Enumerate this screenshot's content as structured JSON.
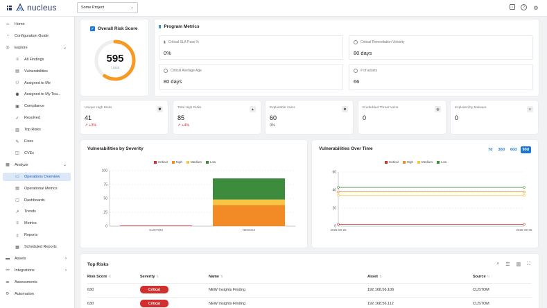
{
  "app": {
    "name": "nucleus",
    "project": "Some Project"
  },
  "sidebar": {
    "items": [
      {
        "label": "Home",
        "icon": "home-icon",
        "level": 1
      },
      {
        "label": "Configuration Guide",
        "icon": "guide-icon",
        "level": 1
      },
      {
        "label": "Explore",
        "icon": "explore-icon",
        "level": 1,
        "caret": "⌄"
      },
      {
        "label": "All Findings",
        "icon": "list-icon",
        "level": 2
      },
      {
        "label": "Vulnerabilities",
        "icon": "vuln-icon",
        "level": 2
      },
      {
        "label": "Assigned to Me",
        "icon": "person-icon",
        "level": 2
      },
      {
        "label": "Assigned to My Tea...",
        "icon": "team-icon",
        "level": 2
      },
      {
        "label": "Compliance",
        "icon": "compliance-icon",
        "level": 2
      },
      {
        "label": "Resolved",
        "icon": "check-icon",
        "level": 2
      },
      {
        "label": "Top Risks",
        "icon": "chart-icon",
        "level": 2
      },
      {
        "label": "Fixes",
        "icon": "fix-icon",
        "level": 2
      },
      {
        "label": "CVEs",
        "icon": "cve-icon",
        "level": 2
      },
      {
        "label": "Analyze",
        "icon": "analyze-icon",
        "level": 1,
        "caret": "⌄"
      },
      {
        "label": "Operations Overview",
        "icon": "overview-icon",
        "level": 2,
        "active": true
      },
      {
        "label": "Operational Metrics",
        "icon": "metrics-icon",
        "level": 2
      },
      {
        "label": "Dashboards",
        "icon": "dashboard-icon",
        "level": 2
      },
      {
        "label": "Trends",
        "icon": "trend-icon",
        "level": 2
      },
      {
        "label": "Metrics",
        "icon": "list-icon",
        "level": 2
      },
      {
        "label": "Reports",
        "icon": "report-icon",
        "level": 2
      },
      {
        "label": "Scheduled Reports",
        "icon": "calendar-icon",
        "level": 2
      },
      {
        "label": "Assets",
        "icon": "assets-icon",
        "level": 1,
        "caret": "›"
      },
      {
        "label": "Integrations",
        "icon": "integrations-icon",
        "level": 1,
        "caret": "›"
      },
      {
        "label": "Assessments",
        "icon": "assessments-icon",
        "level": 1
      },
      {
        "label": "Automation",
        "icon": "automation-icon",
        "level": 1
      }
    ]
  },
  "risk": {
    "title": "Overall Risk Score",
    "score": "595",
    "max": "/ 1000",
    "fraction": 0.595,
    "color": "#f59a23"
  },
  "program": {
    "title": "Program Metrics",
    "metrics": [
      {
        "label": "Critical SLA Pass %",
        "value": "0%"
      },
      {
        "label": "Critical Remediation Velocity",
        "value": "80 days"
      },
      {
        "label": "Critical Average Age",
        "value": "80 days"
      },
      {
        "label": "# of assets",
        "value": "66"
      }
    ]
  },
  "kpis": [
    {
      "label": "Unique High Risks",
      "value": "41",
      "delta": "+3%",
      "trend": "up"
    },
    {
      "label": "Total High Risks",
      "value": "85",
      "delta": "+4%",
      "trend": "up"
    },
    {
      "label": "Exploitable Vulns",
      "value": "60",
      "delta": "0%",
      "trend": "flat"
    },
    {
      "label": "Emdedded Threat Vulns",
      "value": "0",
      "delta": "",
      "trend": "none"
    },
    {
      "label": "Exploited by Malware",
      "value": "0",
      "delta": "",
      "trend": "none"
    }
  ],
  "colors": {
    "critical": "#d32f2f",
    "high": "#f28a25",
    "medium": "#f7c443",
    "low": "#3d8b3d",
    "accent": "#1976d2"
  },
  "chart_data": [
    {
      "type": "bar",
      "title": "Vulnerabilities by Severity",
      "categories": [
        "CUSTOM",
        "NESSUS"
      ],
      "series": [
        {
          "name": "Critical",
          "values": [
            1,
            0
          ]
        },
        {
          "name": "High",
          "values": [
            0,
            38
          ]
        },
        {
          "name": "Medium",
          "values": [
            0,
            10
          ]
        },
        {
          "name": "Low",
          "values": [
            0,
            38
          ]
        }
      ],
      "stacked": true,
      "ylim": [
        0,
        100
      ],
      "yticks": [
        0,
        25,
        50,
        75,
        100
      ],
      "legend": "top-center",
      "grid": true
    },
    {
      "type": "line",
      "title": "Vulnerabilities Over Time",
      "x": [
        "2025-08-25",
        "2025-09-05"
      ],
      "series": [
        {
          "name": "Critical",
          "values": [
            2,
            2
          ]
        },
        {
          "name": "High",
          "values": [
            38,
            38
          ]
        },
        {
          "name": "Medium",
          "values": [
            34,
            34
          ]
        },
        {
          "name": "Low",
          "values": [
            43,
            43
          ]
        },
        {
          "name": "",
          "values": [
            38,
            38
          ]
        }
      ],
      "ylim": [
        0,
        60
      ],
      "yticks": [
        0,
        20,
        40,
        60
      ],
      "legend": "top-center",
      "ranges": [
        "7d",
        "30d",
        "60d",
        "90d"
      ],
      "selected_range": "90d"
    }
  ],
  "top_risks": {
    "title": "Top Risks",
    "columns": [
      "Risk Score",
      "Severity",
      "Name",
      "Asset",
      "Source"
    ],
    "rows": [
      {
        "score": "630",
        "severity": "Critical",
        "name": "NEW Insights Finding",
        "asset": "192.168.56.106",
        "source": "CUSTOM"
      },
      {
        "score": "630",
        "severity": "Critical",
        "name": "NEW Insights Finding",
        "asset": "192.168.56.112",
        "source": "CUSTOM"
      }
    ]
  }
}
